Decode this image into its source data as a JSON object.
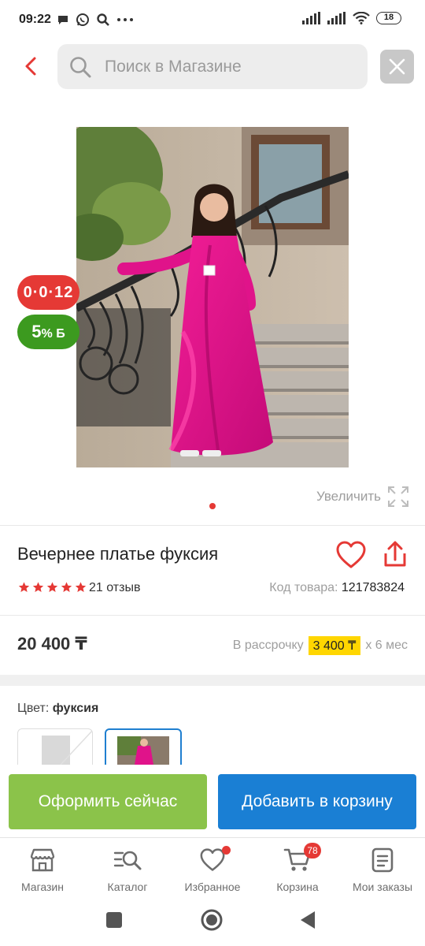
{
  "status_bar": {
    "time": "09:22",
    "battery": "18"
  },
  "search": {
    "placeholder": "Поиск в Магазине"
  },
  "badges": {
    "installment": "0·0·12",
    "bonus_value": "5",
    "bonus_suffix": "% Б"
  },
  "gallery": {
    "zoom_label": "Увеличить",
    "current_page": 1
  },
  "product": {
    "title": "Вечернее платье фуксия",
    "rating": 5,
    "reviews": "21 отзыв",
    "sku_label": "Код товара:",
    "sku_value": "121783824",
    "price": "20 400 ₸",
    "installment_label": "В рассрочку",
    "installment_amount": "3 400 ₸",
    "installment_term": "х 6 мес",
    "color_label": "Цвет:",
    "color_value": "фуксия"
  },
  "actions": {
    "buy_now": "Оформить сейчас",
    "add_to_cart": "Добавить в корзину"
  },
  "bottom_nav": [
    {
      "label": "Магазин",
      "icon": "shop-icon"
    },
    {
      "label": "Каталог",
      "icon": "catalog-search-icon"
    },
    {
      "label": "Избранное",
      "icon": "heart-icon"
    },
    {
      "label": "Корзина",
      "icon": "cart-icon",
      "badge": "78"
    },
    {
      "label": "Мои заказы",
      "icon": "orders-icon"
    }
  ],
  "colors": {
    "accent_red": "#e53935",
    "buy_green": "#8bc34a",
    "cart_blue": "#1a7fd4",
    "bonus_green": "#3c9a1f",
    "dress_fuchsia": "#e0138a",
    "installment_yellow": "#ffd600"
  }
}
